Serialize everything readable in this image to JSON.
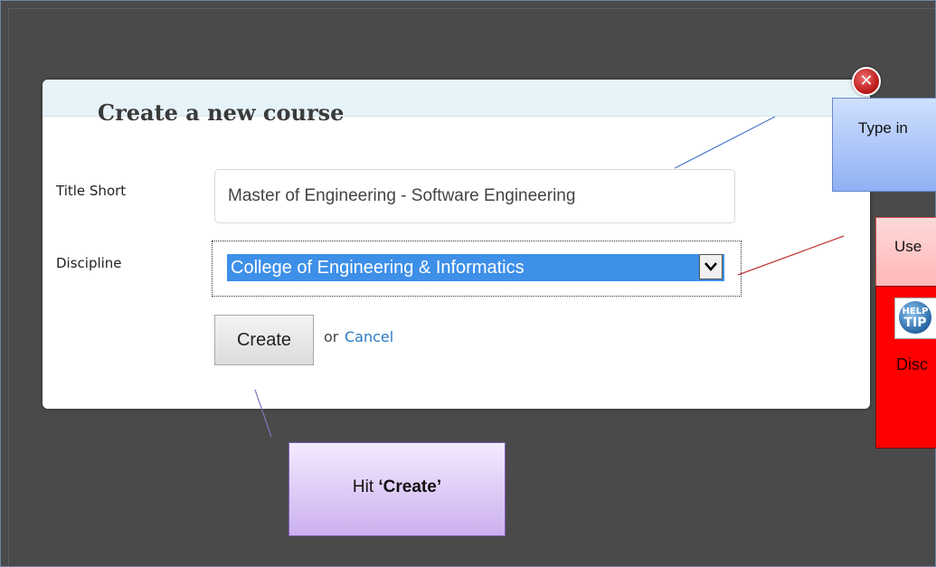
{
  "dialog": {
    "title": "Create a new course",
    "close_icon": "close-icon",
    "fields": {
      "title_short_label": "Title Short",
      "title_short_value": "Master of Engineering - Software Engineering",
      "discipline_label": "Discipline",
      "discipline_value": "College of Engineering & Informatics"
    },
    "create_label": "Create",
    "or_text": "or",
    "cancel_label": "Cancel"
  },
  "callouts": {
    "type_in": "Type in",
    "use": "Use",
    "hit_prefix": "Hit ",
    "hit_bold": "‘Create’",
    "help_badge_top": "HELP",
    "help_badge_bottom": "TIP",
    "disc_partial": "Disc"
  },
  "colors": {
    "background": "#4a4a4a",
    "header_bg": "#e6f3f8",
    "select_highlight": "#3d8fe8",
    "link": "#2a7ac4",
    "callout_blue": "#8fb0f3",
    "callout_red": "#ff0000",
    "callout_purple": "#cbb0ee"
  }
}
